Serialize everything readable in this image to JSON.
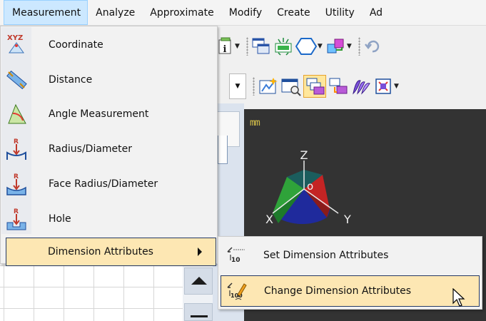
{
  "menubar": {
    "items": [
      {
        "label": "Measurement",
        "active": true
      },
      {
        "label": "Analyze"
      },
      {
        "label": "Approximate"
      },
      {
        "label": "Modify"
      },
      {
        "label": "Create"
      },
      {
        "label": "Utility"
      },
      {
        "label": "Ad"
      }
    ]
  },
  "viewport": {
    "units": "mm",
    "axes": {
      "z": "Z",
      "x": "X",
      "y": "Y"
    },
    "background": "#333333"
  },
  "measurement_menu": {
    "items": [
      {
        "label": "Coordinate",
        "icon": "coordinate-xyz-icon"
      },
      {
        "label": "Distance",
        "icon": "distance-ruler-icon"
      },
      {
        "label": "Angle Measurement",
        "icon": "angle-icon"
      },
      {
        "label": "Radius/Diameter",
        "icon": "radius-icon"
      },
      {
        "label": "Face Radius/Diameter",
        "icon": "face-radius-icon"
      },
      {
        "label": "Hole",
        "icon": "hole-icon"
      },
      {
        "label": "Dimension Attributes",
        "icon": null,
        "has_submenu": true,
        "highlighted": true
      }
    ]
  },
  "dimension_attributes_submenu": {
    "items": [
      {
        "label": "Set Dimension Attributes",
        "icon": "set-dimension-attributes-icon"
      },
      {
        "label": "Change Dimension Attributes",
        "icon": "change-dimension-attributes-icon",
        "highlighted": true
      }
    ]
  },
  "colors": {
    "highlight_bg": "#fde7b3",
    "highlight_border": "#263a64",
    "menubar_active": "#cce8ff",
    "toolbar_selected": "#ffe79c"
  }
}
